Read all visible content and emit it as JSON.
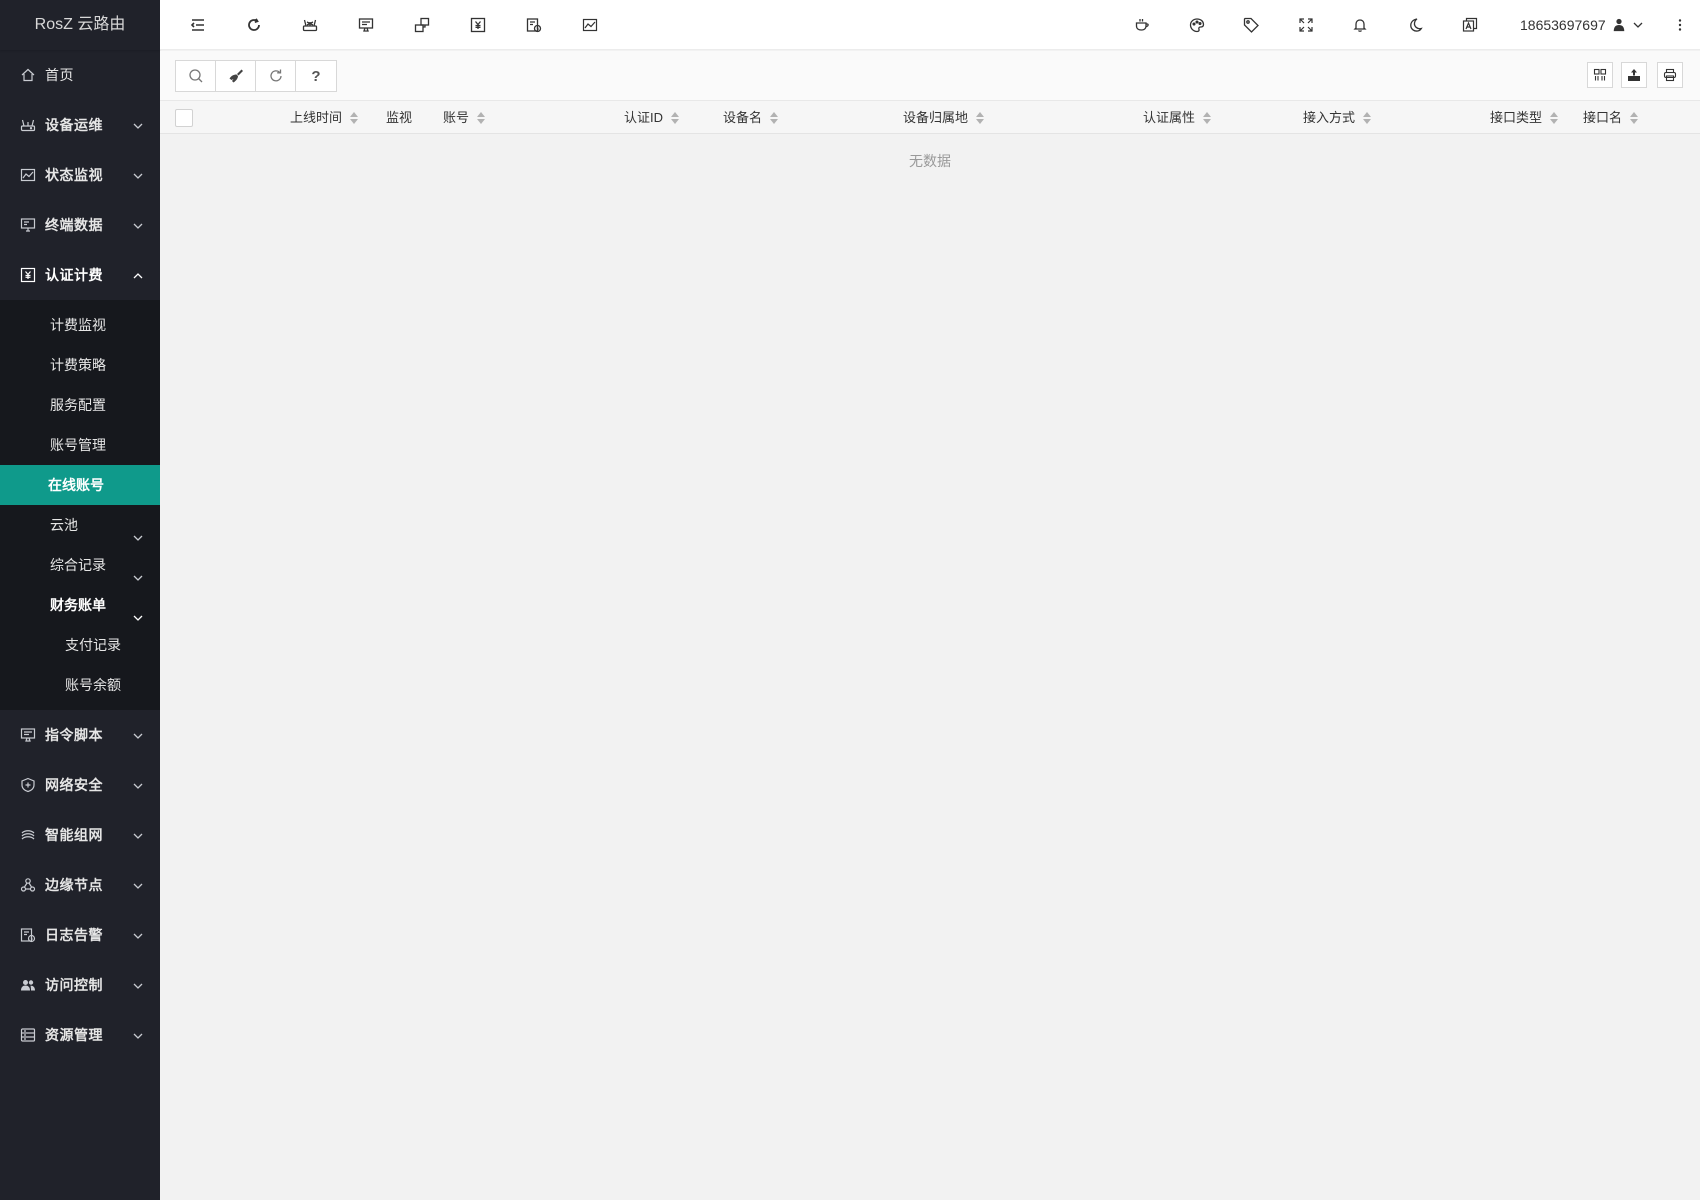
{
  "app": {
    "logo_text": "RosZ 云路由"
  },
  "sidebar": {
    "items": [
      {
        "label": "首页",
        "icon": "home-icon"
      },
      {
        "label": "设备运维",
        "icon": "router-icon"
      },
      {
        "label": "状态监视",
        "icon": "monitor-chart-icon"
      },
      {
        "label": "终端数据",
        "icon": "desktop-icon"
      },
      {
        "label": "认证计费",
        "icon": "billing-icon"
      },
      {
        "label": "指令脚本",
        "icon": "script-icon"
      },
      {
        "label": "网络安全",
        "icon": "shield-icon"
      },
      {
        "label": "智能组网",
        "icon": "network-layers-icon"
      },
      {
        "label": "边缘节点",
        "icon": "nodes-icon"
      },
      {
        "label": "日志告警",
        "icon": "log-alert-icon"
      },
      {
        "label": "访问控制",
        "icon": "users-icon"
      },
      {
        "label": "资源管理",
        "icon": "resource-icon"
      }
    ],
    "sub": {
      "billing_monitor": "计费监视",
      "billing_policy": "计费策略",
      "service_config": "服务配置",
      "account_mgmt": "账号管理",
      "online_accounts": "在线账号",
      "cloud_pool": "云池",
      "records": "综合记录",
      "finance": "财务账单",
      "payment_records": "支付记录",
      "account_balance": "账号余额"
    }
  },
  "header": {
    "user": "18653697697"
  },
  "toolbar": {
    "help_label": "?"
  },
  "table": {
    "columns": [
      "上线时间",
      "监视",
      "账号",
      "认证ID",
      "设备名",
      "设备归属地",
      "认证属性",
      "接入方式",
      "接口类型",
      "接口名"
    ],
    "empty_text": "无数据"
  },
  "colors": {
    "sidebar_bg": "#20222a",
    "submenu_bg": "#16181d",
    "accent": "#0f9a8b"
  }
}
